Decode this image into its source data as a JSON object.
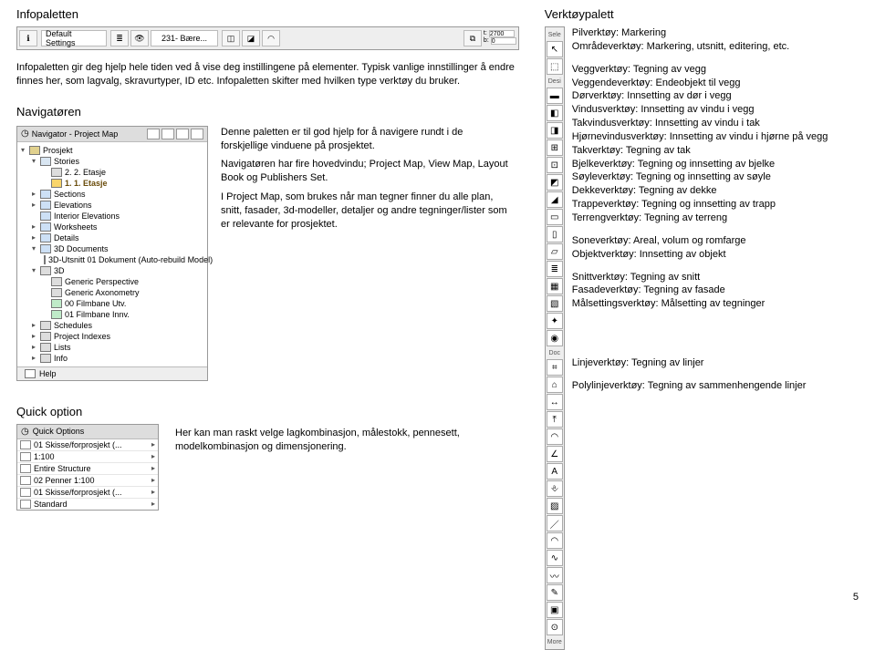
{
  "left": {
    "infopalette_title": "Infopaletten",
    "infobar": {
      "default_label": "Default Settings",
      "layer_value": "231- Bære...",
      "field_t": "2700",
      "field_b": "0"
    },
    "info_text": "Infopaletten gir deg hjelp hele tiden ved å vise deg instillingene på elementer. Typisk vanlige innstillinger å endre finnes her, som lagvalg, skravurtyper, ID etc. Infopaletten skifter med hvilken type verktøy du bruker.",
    "navigator_title": "Navigatøren",
    "nav_panel_title": "Navigator - Project Map",
    "tree": [
      {
        "caret": "d",
        "indent": 0,
        "icon": "folder",
        "bold": false,
        "label": "Prosjekt"
      },
      {
        "caret": "d",
        "indent": 1,
        "icon": "story",
        "bold": false,
        "label": "Stories"
      },
      {
        "caret": "n",
        "indent": 2,
        "icon": "gray",
        "bold": false,
        "label": "2. 2. Etasje"
      },
      {
        "caret": "n",
        "indent": 2,
        "icon": "sel",
        "bold": true,
        "label": "1. 1. Etasje"
      },
      {
        "caret": "r",
        "indent": 1,
        "icon": "blue",
        "bold": false,
        "label": "Sections"
      },
      {
        "caret": "r",
        "indent": 1,
        "icon": "blue",
        "bold": false,
        "label": "Elevations"
      },
      {
        "caret": "n",
        "indent": 1,
        "icon": "blue",
        "bold": false,
        "label": "Interior Elevations"
      },
      {
        "caret": "r",
        "indent": 1,
        "icon": "blue",
        "bold": false,
        "label": "Worksheets"
      },
      {
        "caret": "r",
        "indent": 1,
        "icon": "blue",
        "bold": false,
        "label": "Details"
      },
      {
        "caret": "d",
        "indent": 1,
        "icon": "blue",
        "bold": false,
        "label": "3D Documents"
      },
      {
        "caret": "n",
        "indent": 2,
        "icon": "blue",
        "bold": false,
        "label": "3D-Utsnitt 01 Dokument (Auto-rebuild Model)"
      },
      {
        "caret": "d",
        "indent": 1,
        "icon": "gray",
        "bold": false,
        "label": "3D"
      },
      {
        "caret": "n",
        "indent": 2,
        "icon": "gray",
        "bold": false,
        "label": "Generic Perspective"
      },
      {
        "caret": "n",
        "indent": 2,
        "icon": "gray",
        "bold": false,
        "label": "Generic Axonometry"
      },
      {
        "caret": "n",
        "indent": 2,
        "icon": "green",
        "bold": false,
        "label": "00 Filmbane Utv."
      },
      {
        "caret": "n",
        "indent": 2,
        "icon": "green",
        "bold": false,
        "label": "01 Filmbane Innv."
      },
      {
        "caret": "r",
        "indent": 1,
        "icon": "gray",
        "bold": false,
        "label": "Schedules"
      },
      {
        "caret": "r",
        "indent": 1,
        "icon": "gray",
        "bold": false,
        "label": "Project Indexes"
      },
      {
        "caret": "r",
        "indent": 1,
        "icon": "gray",
        "bold": false,
        "label": "Lists"
      },
      {
        "caret": "r",
        "indent": 1,
        "icon": "gray",
        "bold": false,
        "label": "Info"
      }
    ],
    "tree_help": "Help",
    "nav_text_p1": "Denne paletten er til god hjelp for å navigere rundt i de forskjellige vinduene på prosjektet.",
    "nav_text_p2": "Navigatøren har fire hovedvindu; Project Map, View Map, Layout Book og Publishers Set.",
    "nav_text_p3": "I Project Map, som brukes når man tegner finner du alle plan, snitt, fasader, 3d-modeller, detaljer og andre tegninger/lister som er relevante for prosjektet."
  },
  "right": {
    "toolpalette_title": "Verktøypalett",
    "sections": {
      "sele": "Sele",
      "desi": "Desi",
      "doc": "Doc",
      "more": "More"
    },
    "sele_desc": [
      "Pilverktøy: Markering",
      "Områdeverktøy: Markering, utsnitt, editering, etc."
    ],
    "desi_desc": [
      "Veggverktøy: Tegning av vegg",
      "Veggendeverktøy: Endeobjekt til vegg",
      "Dørverktøy: Innsetting av dør i vegg",
      "Vindusverktøy: Innsetting av vindu i vegg",
      "Takvindusverktøy: Innsetting av vindu i tak",
      "Hjørnevindusverktøy: Innsetting av vindu i hjørne på vegg",
      "Takverktøy: Tegning av tak",
      "Bjelkeverktøy: Tegning og innsetting av bjelke",
      "Søyleverktøy: Tegning og innsetting av søyle",
      "Dekkeverktøy: Tegning av dekke",
      "Trappeverktøy: Tegning og innsetting av trapp",
      "Terrengverktøy: Tegning av terreng"
    ],
    "zone_desc": [
      "Soneverktøy: Areal, volum og romfarge",
      "Objektverktøy: Innsetting av objekt"
    ],
    "doc_desc": [
      "Snittverktøy: Tegning av snitt",
      "Fasadeverktøy: Tegning av fasade",
      "Målsettingsverktøy: Målsetting av tegninger"
    ],
    "line_desc": "Linjeverktøy: Tegning av linjer",
    "poly_desc": "Polylinjeverktøy: Tegning av sammenhengende linjer",
    "tools": {
      "arrow": "↖",
      "marquee": "⬚",
      "wall": "▬",
      "wallend": "◧",
      "door": "◨",
      "window": "⊞",
      "roofwindow": "⊡",
      "cornerwindow": "◩",
      "roof": "◢",
      "beam": "▭",
      "column": "▯",
      "slab": "▱",
      "stair": "≣",
      "mesh": "▦",
      "zone": "▧",
      "object": "✦",
      "lamp": "◉",
      "section": "⌗",
      "elevation": "⌂",
      "dimension": "↔",
      "level": "⤒",
      "radial": "◠",
      "angle": "∠",
      "text": "A",
      "label": "⎀",
      "fill": "▨",
      "line": "／",
      "arc": "◠",
      "poly": "∿",
      "spline": "〰",
      "draw": "✎",
      "fig": "▣",
      "hot": "⊙"
    }
  },
  "quick": {
    "title": "Quick option",
    "panel_title": "Quick Options",
    "rows": [
      "01 Skisse/forprosjekt (...",
      "1:100",
      "Entire Structure",
      "02 Penner 1:100",
      "01 Skisse/forprosjekt (...",
      "Standard"
    ],
    "text": "Her kan man raskt velge lagkombinasjon, målestokk, pennesett, modelkombinasjon og dimensjonering."
  },
  "pagenum": "5"
}
